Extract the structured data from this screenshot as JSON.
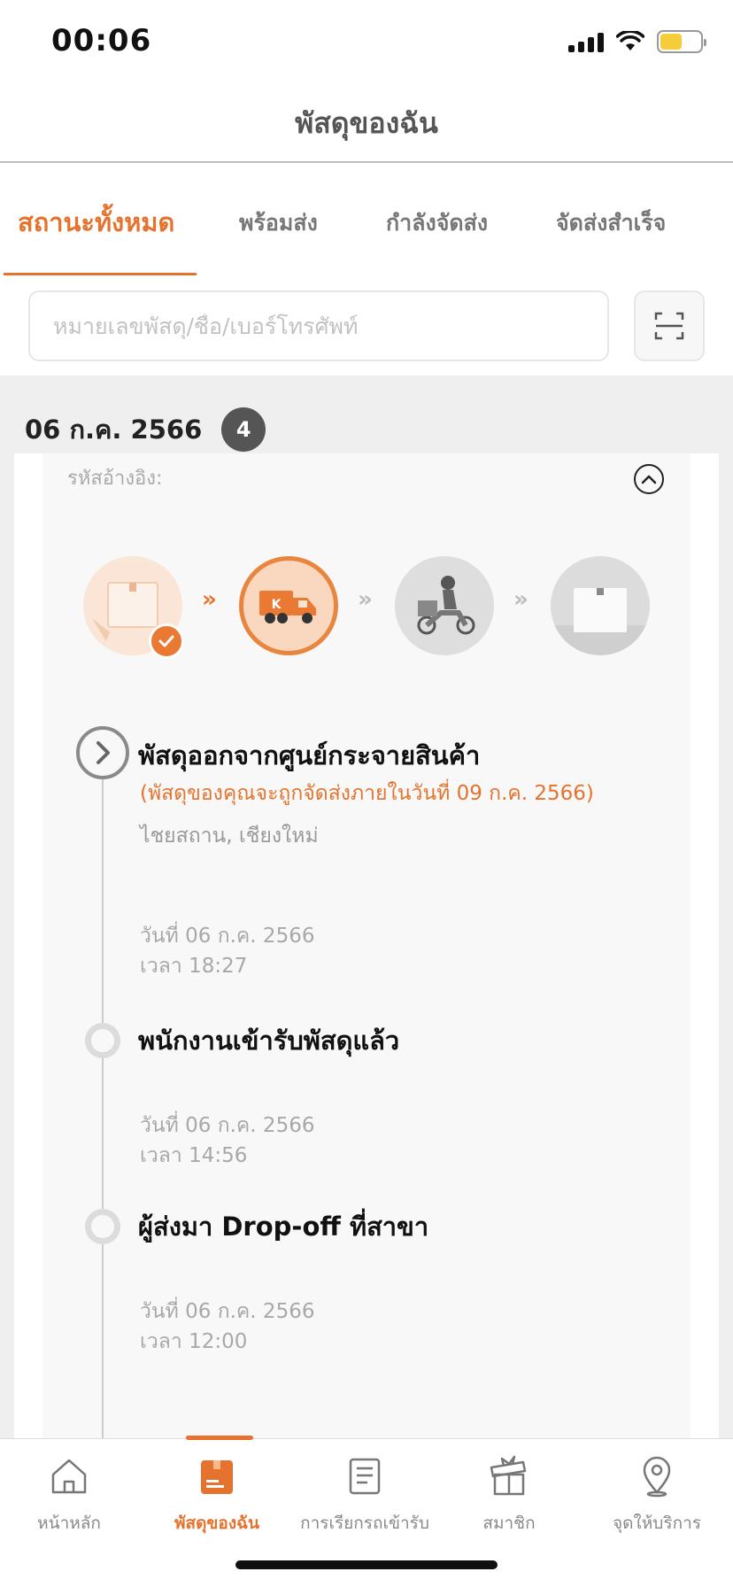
{
  "status_bar": {
    "time": "00:06",
    "icons": [
      "signal-icon",
      "wifi-icon",
      "battery-icon"
    ],
    "battery_color": "#f5cc3a"
  },
  "header": {
    "title": "พัสดุของฉัน"
  },
  "tabs": [
    {
      "label": "สถานะทั้งหมด",
      "active": true
    },
    {
      "label": "พร้อมส่ง",
      "active": false
    },
    {
      "label": "กำลังจัดส่ง",
      "active": false
    },
    {
      "label": "จัดส่งสำเร็จ",
      "active": false
    }
  ],
  "search": {
    "placeholder": "หมายเลขพัสดุ/ชื่อ/เบอร์โทรศัพท์",
    "value": "",
    "scan_icon": "scan-icon"
  },
  "group": {
    "date": "06 ก.ค. 2566",
    "count": "4"
  },
  "parcel": {
    "ref_label": "รหัสอ้างอิง:",
    "ref_value": "",
    "collapse_icon": "chevron-up-icon",
    "steps": [
      {
        "name": "packed",
        "state": "done",
        "icon": "parcel-box-icon"
      },
      {
        "name": "in-transit",
        "state": "current",
        "icon": "delivery-truck-icon"
      },
      {
        "name": "out-for-delivery",
        "state": "pending",
        "icon": "scooter-rider-icon"
      },
      {
        "name": "delivered",
        "state": "pending",
        "icon": "delivered-box-icon"
      }
    ],
    "timeline": [
      {
        "title": "พัสดุออกจากศูนย์กระจายสินค้า",
        "note": "(พัสดุของคุณจะถูกจัดส่งภายในวันที่ 09 ก.ค. 2566)",
        "location": "ไชยสถาน, เชียงใหม่",
        "date": "วันที่ 06 ก.ค. 2566",
        "time": "เวลา 18:27"
      },
      {
        "title": "พนักงานเข้ารับพัสดุแล้ว",
        "date": "วันที่ 06 ก.ค. 2566",
        "time": "เวลา 14:56"
      },
      {
        "title": "ผู้ส่งมา Drop-off ที่สาขา",
        "date": "วันที่ 06 ก.ค. 2566",
        "time": "เวลา 12:00"
      }
    ]
  },
  "bottom_nav": [
    {
      "label": "หน้าหลัก",
      "icon": "home-icon",
      "active": false
    },
    {
      "label": "พัสดุของฉัน",
      "icon": "parcel-icon",
      "active": true
    },
    {
      "label": "การเรียกรถเข้ารับ",
      "icon": "document-list-icon",
      "active": false
    },
    {
      "label": "สมาชิก",
      "icon": "gift-icon",
      "active": false
    },
    {
      "label": "จุดให้บริการ",
      "icon": "location-pin-icon",
      "active": false
    }
  ],
  "colors": {
    "accent": "#e5732d",
    "background": "#efefef",
    "card": "#f8f8f8"
  }
}
